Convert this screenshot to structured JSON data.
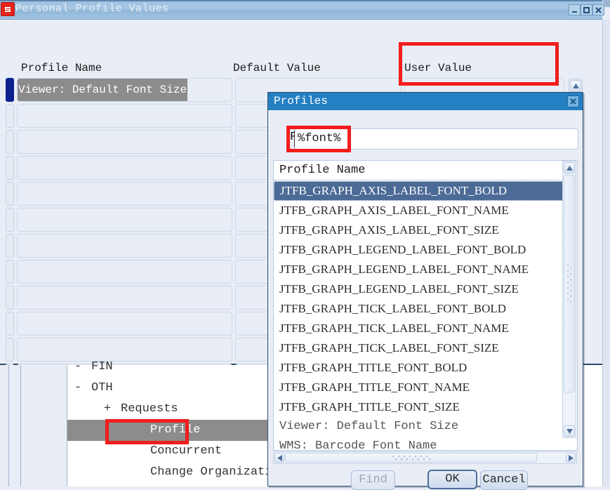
{
  "window": {
    "title": "Personal Profile Values",
    "icon": "oracle-forms-icon",
    "controls": {
      "minimize": "minimize-icon",
      "maximize": "maximize-icon",
      "close": "close-icon"
    }
  },
  "form": {
    "columns": [
      "Profile Name",
      "Default Value",
      "User Value"
    ],
    "rows": [
      {
        "profile_name": "Viewer: Default Font Size",
        "default_value": "",
        "user_value": "",
        "selected": true
      },
      {
        "profile_name": "",
        "default_value": "",
        "user_value": "",
        "selected": false
      },
      {
        "profile_name": "",
        "default_value": "",
        "user_value": "",
        "selected": false
      },
      {
        "profile_name": "",
        "default_value": "",
        "user_value": "",
        "selected": false
      },
      {
        "profile_name": "",
        "default_value": "",
        "user_value": "",
        "selected": false
      },
      {
        "profile_name": "",
        "default_value": "",
        "user_value": "",
        "selected": false
      },
      {
        "profile_name": "",
        "default_value": "",
        "user_value": "",
        "selected": false
      },
      {
        "profile_name": "",
        "default_value": "",
        "user_value": "",
        "selected": false
      },
      {
        "profile_name": "",
        "default_value": "",
        "user_value": "",
        "selected": false
      },
      {
        "profile_name": "",
        "default_value": "",
        "user_value": "",
        "selected": false
      },
      {
        "profile_name": "",
        "default_value": "",
        "user_value": "",
        "selected": false
      },
      {
        "profile_name": "",
        "default_value": "",
        "user_value": "",
        "selected": false
      }
    ]
  },
  "navigator": {
    "items": [
      {
        "label": "FIN",
        "toggle": "-",
        "indent": 0,
        "selected": false,
        "clipped": true
      },
      {
        "label": "OTH",
        "toggle": "-",
        "indent": 0,
        "selected": false
      },
      {
        "label": "Requests",
        "toggle": "+",
        "indent": 1,
        "selected": false
      },
      {
        "label": "Profile",
        "toggle": "",
        "indent": 2,
        "selected": true
      },
      {
        "label": "Concurrent",
        "toggle": "",
        "indent": 2,
        "selected": false
      },
      {
        "label": "Change Organization",
        "toggle": "",
        "indent": 2,
        "selected": false
      }
    ]
  },
  "dialog": {
    "title": "Profiles",
    "close_icon": "close-icon",
    "find_label": "Find",
    "find_value": "%font%",
    "find_placeholder": "",
    "list_header": "Profile Name",
    "list_items": [
      {
        "label": "JTFB_GRAPH_AXIS_LABEL_FONT_BOLD",
        "selected": true
      },
      {
        "label": "JTFB_GRAPH_AXIS_LABEL_FONT_NAME",
        "selected": false
      },
      {
        "label": "JTFB_GRAPH_AXIS_LABEL_FONT_SIZE",
        "selected": false
      },
      {
        "label": "JTFB_GRAPH_LEGEND_LABEL_FONT_BOLD",
        "selected": false
      },
      {
        "label": "JTFB_GRAPH_LEGEND_LABEL_FONT_NAME",
        "selected": false
      },
      {
        "label": "JTFB_GRAPH_LEGEND_LABEL_FONT_SIZE",
        "selected": false
      },
      {
        "label": "JTFB_GRAPH_TICK_LABEL_FONT_BOLD",
        "selected": false
      },
      {
        "label": "JTFB_GRAPH_TICK_LABEL_FONT_NAME",
        "selected": false
      },
      {
        "label": "JTFB_GRAPH_TICK_LABEL_FONT_SIZE",
        "selected": false
      },
      {
        "label": "JTFB_GRAPH_TITLE_FONT_BOLD",
        "selected": false
      },
      {
        "label": "JTFB_GRAPH_TITLE_FONT_NAME",
        "selected": false
      },
      {
        "label": "JTFB_GRAPH_TITLE_FONT_SIZE",
        "selected": false
      },
      {
        "label": "Viewer: Default Font Size",
        "selected": false,
        "serif": true
      },
      {
        "label": "WMS: Barcode Font Name",
        "selected": false,
        "serif": true
      }
    ],
    "buttons": {
      "find": "Find",
      "ok": "OK",
      "cancel": "Cancel"
    },
    "find_enabled": false
  },
  "annotations": {
    "boxes": [
      {
        "name": "user-value-highlight",
        "color": "#f41d1d"
      },
      {
        "name": "find-field-highlight",
        "color": "#f41d1d"
      },
      {
        "name": "profile-node-highlight",
        "color": "#f41d1d"
      }
    ]
  },
  "colors": {
    "titlebar": "#a4c4e2",
    "dialog_titlebar": "#2580c3",
    "selection_blue": "#4c6a96",
    "selection_gray": "#8c8c8c",
    "row_selector_selected": "#0b1f8f",
    "annotation_red": "#f41d1d",
    "form_background": "#e9edf5"
  }
}
